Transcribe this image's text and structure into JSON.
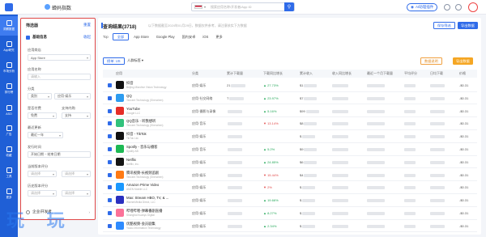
{
  "topbar": {
    "app_name": "蝉妈指数",
    "search_flag": "US",
    "search_dropdown": "▾",
    "search_placeholder": "搜索应用名称/开发者/App ID",
    "ai_button": "AI助理插件"
  },
  "nav": {
    "items": [
      {
        "label": "洞察数据"
      },
      {
        "label": "App研究"
      },
      {
        "label": "市场分析"
      },
      {
        "label": "排行榜"
      },
      {
        "label": "ASO"
      },
      {
        "label": "广告"
      },
      {
        "label": "收藏"
      },
      {
        "label": "工具"
      },
      {
        "label": "更多"
      }
    ]
  },
  "filter": {
    "title": "筛选器",
    "reset": "重置",
    "section1": "基础信息",
    "section1_action": "收起",
    "fields": [
      {
        "label": "应用商店",
        "value": "App Store"
      },
      {
        "label": "应用名称",
        "value": "请输入"
      },
      {
        "label": "分类",
        "value_left": "类别",
        "value_right": "应用·娱乐"
      },
      {
        "label": "是否付费",
        "value_left": "免费",
        "label_right": "支持内购",
        "value_right": "支持"
      },
      {
        "label": "最近更新",
        "value": "最近一年"
      },
      {
        "label": "发行时间",
        "value": "开始日期 ~ 结束日期"
      },
      {
        "label": "当前版本评分",
        "value_left": "请选择",
        "value_right": "请选择"
      },
      {
        "label": "历史版本评分",
        "value_left": "请选择",
        "value_right": "请选择"
      }
    ],
    "footer": "企业/开发者"
  },
  "main": {
    "title": "查询结果(3718)",
    "subtitle": "以下数据截至2024年01月29日，数据仅供参考，请注意核实下方数据",
    "btn_outline": "保存筛选",
    "btn_solid": "导出数据",
    "tabs_label": "Top",
    "tabs": [
      "全部",
      "App Store",
      "Google Play",
      "国内安卓",
      "iOS",
      "更多"
    ],
    "active_tab": "全部",
    "toolbar_chip": "榜单: US",
    "toolbar_select": "人群标签 ▾",
    "toolbar_r1": "数据说明",
    "toolbar_r2": "导出数据",
    "columns": [
      "应用",
      "分类",
      "累计下载量",
      "下载同比增长",
      "累计收入",
      "收入同比增长",
      "最近一个月下载量",
      "平均评分",
      "日均下载",
      "价格"
    ]
  },
  "rows": [
    {
      "name": "抖音",
      "dev": "Beijing Microlive Vision Technology",
      "cat": "应用·娱乐",
      "dl": "21",
      "growth": "27.73%",
      "dir": "up",
      "rev": "$1",
      "price": "-$0.31",
      "icon_color": "#111111"
    },
    {
      "name": "QQ",
      "dev": "Tencent Technology (Shenzhen)",
      "cat": "应用·社交网络",
      "dl": "T",
      "growth": "23.97%",
      "dir": "up",
      "rev": "$7",
      "price": "-$0.31",
      "icon_color": "#2d9cf0"
    },
    {
      "name": "YouTube",
      "dev": "Google LLC",
      "cat": "应用·摄影与录像",
      "dl": "",
      "growth": "5.16%",
      "dir": "up",
      "rev": "$99",
      "price": "-$0.31",
      "icon_color": "#e52d27"
    },
    {
      "name": "QQ音乐 - 听我想听",
      "dev": "Tencent Technology (Shenzhen)",
      "cat": "应用·音乐",
      "dl": "",
      "growth": "13.14%",
      "dir": "down",
      "rev": "$8",
      "price": "-$0.31",
      "icon_color": "#31c27c"
    },
    {
      "name": "抖音 - TikTok",
      "dev": "TikTok Ltd.",
      "cat": "应用·娱乐",
      "dl": "",
      "growth": "",
      "dir": "up",
      "rev": "$",
      "price": "-$0.31",
      "icon_color": "#111111"
    },
    {
      "name": "Spotify - 音乐与播客",
      "dev": "Spotify AB",
      "cat": "应用·音乐",
      "dl": "",
      "growth": "5.2%",
      "dir": "up",
      "rev": "$9",
      "price": "-$0.31",
      "icon_color": "#1db954"
    },
    {
      "name": "Netflix",
      "dev": "Netflix, Inc.",
      "cat": "应用·娱乐",
      "dl": "",
      "growth": "24.85%",
      "dir": "up",
      "rev": "$6",
      "price": "-$0.31",
      "icon_color": "#141414"
    },
    {
      "name": "腾讯视频-长视频追剧",
      "dev": "Tencent Technology (Shenzhen)",
      "cat": "应用·娱乐",
      "dl": "",
      "growth": "15.44%",
      "dir": "down",
      "rev": "$4",
      "price": "-$0.31",
      "icon_color": "#ff7a14"
    },
    {
      "name": "Amazon Prime Video",
      "dev": "AMZN Mobile LLC",
      "cat": "应用·娱乐",
      "dl": "",
      "growth": "2%",
      "dir": "down",
      "rev": "$",
      "price": "-$0.31",
      "icon_color": "#1a98ff"
    },
    {
      "name": "Max: Stream HBO, TV, & ...",
      "dev": "WarnerMedia Direct, LLC",
      "cat": "应用·娱乐",
      "dl": "",
      "growth": "19.66%",
      "dir": "up",
      "rev": "$",
      "price": "-$0.31",
      "icon_color": "#2a2fbf"
    },
    {
      "name": "哔哩哔哩-弹幕番剧直播",
      "dev": "Shanghai Kuanyu Digital",
      "cat": "应用·娱乐",
      "dl": "",
      "growth": "8.27%",
      "dir": "up",
      "rev": "$",
      "price": "-$0.31",
      "icon_color": "#fb7299"
    },
    {
      "name": "优酷视频-会员剧集",
      "dev": "Youku Information Technology",
      "cat": "应用·娱乐",
      "dl": "",
      "growth": "2.34%",
      "dir": "up",
      "rev": "$",
      "price": "-$0.31",
      "icon_color": "#2e8bff"
    }
  ],
  "watermark": "玩 玩"
}
